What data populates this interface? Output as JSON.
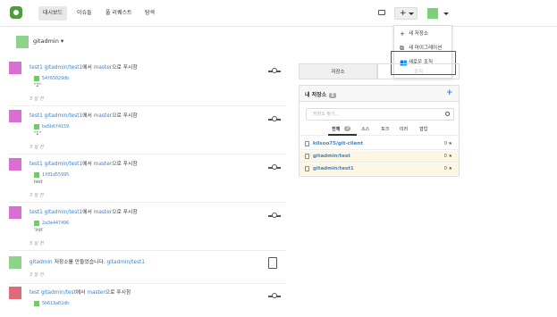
{
  "nav": {
    "items": [
      "대시보드",
      "이슈들",
      "풀 리퀘스트",
      "탐색"
    ]
  },
  "dropdown": {
    "items": [
      "새 저장소",
      "새 마이그레이션",
      "새로운 조직"
    ]
  },
  "context": {
    "name": "gitadmin"
  },
  "feed": [
    {
      "actor": "test1",
      "repo": "gitadmin/test1",
      "mid": "에서",
      "branch": "master",
      "suffix": "으로 푸시함",
      "sha": "54f65029db",
      "msg": "\"2\"",
      "time": "3 일 전",
      "avatar_color": "#d86fd1"
    },
    {
      "actor": "test1",
      "repo": "gitadmin/test1",
      "mid": "에서",
      "branch": "master",
      "suffix": "으로 푸시함",
      "sha": "ba5b6f4159",
      "msg": "\"1\"",
      "time": "3 일 전",
      "avatar_color": "#d86fd1"
    },
    {
      "actor": "test1",
      "repo": "gitadmin/test1",
      "mid": "에서",
      "branch": "master",
      "suffix": "으로 푸시함",
      "sha": "1f01d55995",
      "msg": "test",
      "time": "3 일 전",
      "avatar_color": "#d86fd1"
    },
    {
      "actor": "test1",
      "repo": "gitadmin/test1",
      "mid": "에서",
      "branch": "master",
      "suffix": "으로 푸시함",
      "sha": "2a3e447496",
      "msg": "'init'",
      "time": "3 일 전",
      "avatar_color": "#d86fd1"
    }
  ],
  "feed_create": {
    "actor": "gitadmin",
    "text": " 저장소를 만들었습니다. ",
    "repo": "gitadmin/test1",
    "time": "3 일 전"
  },
  "feed_last": {
    "actor": "test",
    "repo": "gitadmin/test",
    "mid": "에서 ",
    "branch": "master",
    "suffix": "으로 푸시함",
    "sha": "5b613a02db"
  },
  "panel": {
    "tabs": [
      "저장소",
      "조직"
    ],
    "header": "내 저장소",
    "count": "3",
    "add": "+",
    "search_placeholder": "저장소 찾기...",
    "filters": [
      "전체",
      "3",
      "소스",
      "포크",
      "미러",
      "협업"
    ],
    "repos": [
      {
        "name": "kilsoo75/git-client",
        "stars": "0 ★",
        "warm": false
      },
      {
        "name": "gitadmin/test",
        "stars": "0 ★",
        "warm": true
      },
      {
        "name": "gitadmin/test1",
        "stars": "0 ★",
        "warm": true
      }
    ]
  }
}
